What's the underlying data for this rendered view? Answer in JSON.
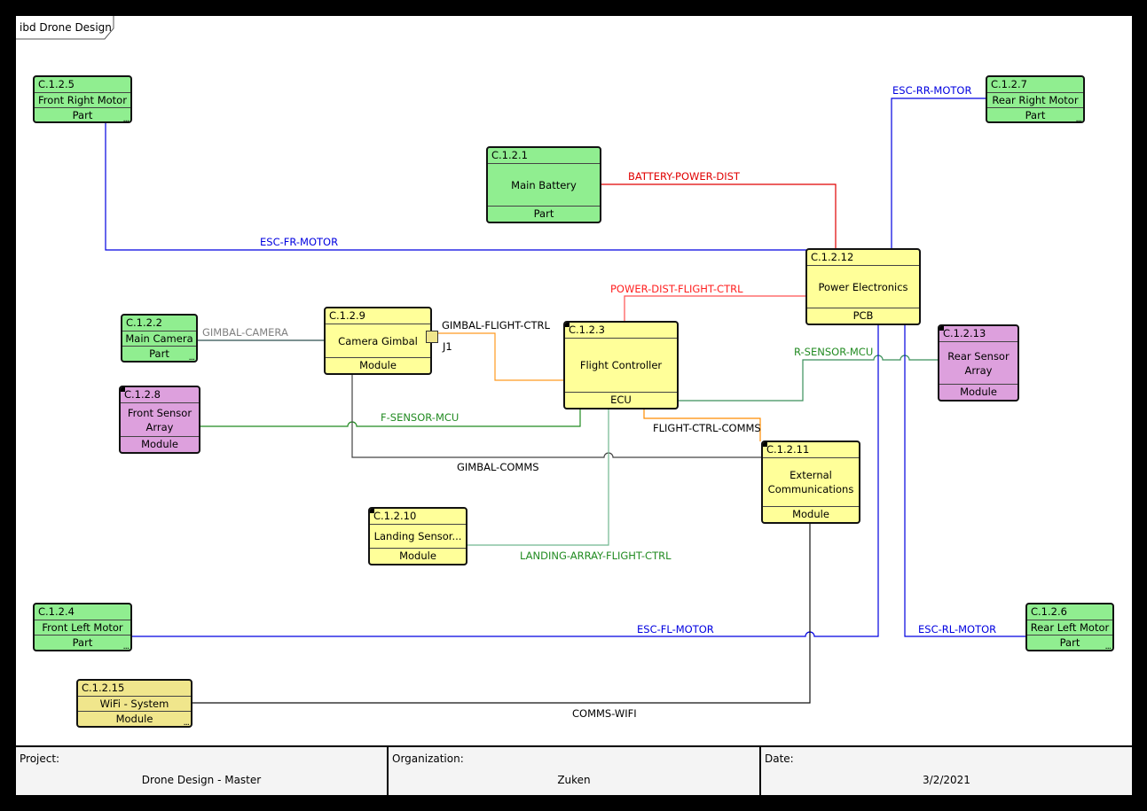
{
  "diagram": {
    "frame_label": "ibd Drone Design"
  },
  "colors": {
    "part": "#90ee90",
    "module": "#ffff99",
    "system": "#f0e68c",
    "sensor": "#dda0dd",
    "power": "#ff0000",
    "esc": "#0000ff",
    "sensor_link": "#228b22",
    "signal": "#ff8c00",
    "comms": "#000000",
    "camera": "#808080"
  },
  "blocks": [
    {
      "id": "C.1.2.5",
      "name": "Front Right Motor",
      "type": "Part",
      "more": "..."
    },
    {
      "id": "C.1.2.7",
      "name": "Rear Right Motor",
      "type": "Part",
      "more": "..."
    },
    {
      "id": "C.1.2.1",
      "name": "Main Battery",
      "type": "Part",
      "more": ""
    },
    {
      "id": "C.1.2.12",
      "name": "Power Electronics",
      "type": "PCB",
      "more": ""
    },
    {
      "id": "C.1.2.2",
      "name": "Main Camera",
      "type": "Part",
      "more": "..."
    },
    {
      "id": "C.1.2.9",
      "name": "Camera Gimbal",
      "type": "Module",
      "more": ""
    },
    {
      "id": "C.1.2.3",
      "name": "Flight Controller",
      "type": "ECU",
      "more": ""
    },
    {
      "id": "C.1.2.13",
      "name": "Rear Sensor Array",
      "type": "Module",
      "more": ""
    },
    {
      "id": "C.1.2.8",
      "name": "Front Sensor Array",
      "type": "Module",
      "more": ""
    },
    {
      "id": "C.1.2.11",
      "name": "External Communications",
      "type": "Module",
      "more": ""
    },
    {
      "id": "C.1.2.10",
      "name": "Landing Sensor...",
      "type": "Module",
      "more": ""
    },
    {
      "id": "C.1.2.4",
      "name": "Front Left Motor",
      "type": "Part",
      "more": "..."
    },
    {
      "id": "C.1.2.6",
      "name": "Rear Left Motor",
      "type": "Part",
      "more": "..."
    },
    {
      "id": "C.1.2.15",
      "name": "WiFi - System",
      "type": "Module",
      "more": "..."
    }
  ],
  "port": {
    "label": "J1"
  },
  "connectors": [
    {
      "name": "BATTERY-POWER-DIST"
    },
    {
      "name": "ESC-RR-MOTOR"
    },
    {
      "name": "ESC-FR-MOTOR"
    },
    {
      "name": "POWER-DIST-FLIGHT-CTRL"
    },
    {
      "name": "GIMBAL-CAMERA"
    },
    {
      "name": "GIMBAL-FLIGHT-CTRL"
    },
    {
      "name": "R-SENSOR-MCU"
    },
    {
      "name": "F-SENSOR-MCU"
    },
    {
      "name": "FLIGHT-CTRL-COMMS"
    },
    {
      "name": "GIMBAL-COMMS"
    },
    {
      "name": "LANDING-ARRAY-FLIGHT-CTRL"
    },
    {
      "name": "ESC-FL-MOTOR"
    },
    {
      "name": "ESC-RL-MOTOR"
    },
    {
      "name": "COMMS-WIFI"
    }
  ],
  "footer": {
    "project_label": "Project:",
    "project": "Drone Design - Master",
    "org_label": "Organization:",
    "org": "Zuken",
    "date_label": "Date:",
    "date": "3/2/2021"
  }
}
